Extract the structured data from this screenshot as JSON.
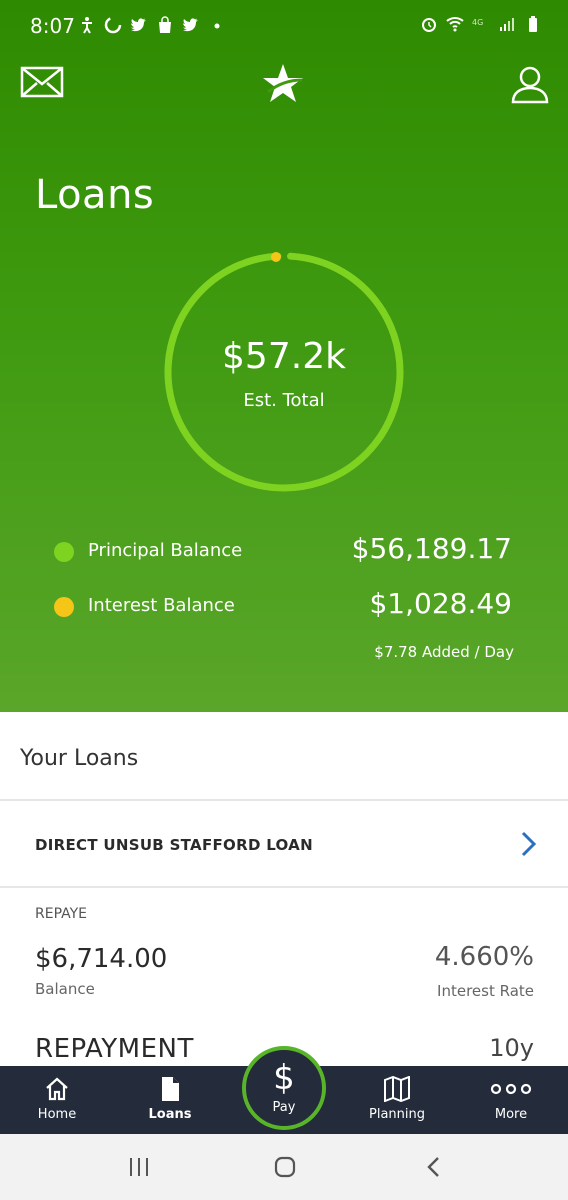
{
  "status_bar": {
    "time": "8:07",
    "left_icons": [
      "accessibility-icon",
      "sync-icon",
      "twitter-icon",
      "shopping-bag-icon",
      "twitter-icon",
      "dot-icon"
    ],
    "right_icons": [
      "alarm-icon",
      "wifi-icon",
      "4g-signal-icon",
      "signal-bars-icon",
      "battery-icon"
    ]
  },
  "header": {
    "mail_icon": "mail-icon",
    "logo_icon": "star-logo-icon",
    "profile_icon": "profile-icon"
  },
  "summary": {
    "title": "Loans",
    "total": "$57.2k",
    "total_label": "Est. Total",
    "principal_label": "Principal Balance",
    "principal_value": "$56,189.17",
    "interest_label": "Interest Balance",
    "interest_value": "$1,028.49",
    "per_day": "$7.78 Added / Day",
    "colors": {
      "principal": "#7ed321",
      "interest": "#f5c518"
    },
    "principal_fraction": 0.982
  },
  "loans": {
    "section_title": "Your Loans",
    "items": [
      {
        "name": "DIRECT UNSUB STAFFORD LOAN",
        "plan": "REPAYE",
        "balance": "$6,714.00",
        "balance_label": "Balance",
        "rate": "4.660%",
        "rate_label": "Interest Rate",
        "repayment_label": "REPAYMENT",
        "repayment_value": "10y"
      }
    ]
  },
  "tabbar": {
    "tabs": [
      {
        "label": "Home",
        "icon": "home-icon",
        "active": false
      },
      {
        "label": "Loans",
        "icon": "document-icon",
        "active": true
      },
      {
        "label": "Pay",
        "icon": "dollar-icon",
        "active": false
      },
      {
        "label": "Planning",
        "icon": "map-icon",
        "active": false
      },
      {
        "label": "More",
        "icon": "more-icon",
        "active": false
      }
    ],
    "accent": "#58b52a"
  },
  "system_nav": [
    "recent-apps-icon",
    "home-circle-icon",
    "back-icon"
  ]
}
